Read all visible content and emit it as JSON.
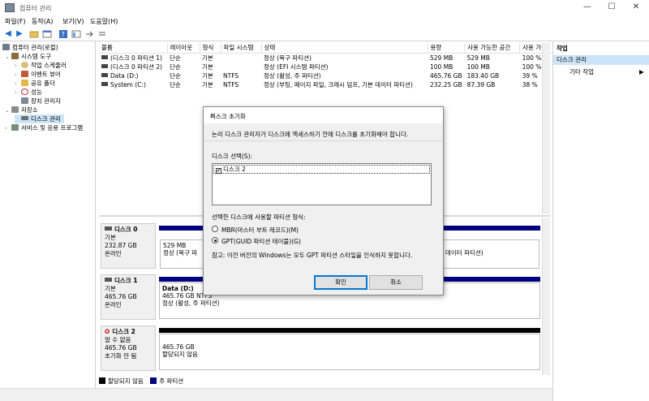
{
  "window": {
    "title": "컴퓨터 관리",
    "minimize": "—",
    "maximize": "☐",
    "close": "✕"
  },
  "menu": {
    "items": [
      "파일(F)",
      "동작(A)",
      "보기(V)",
      "도움말(H)"
    ]
  },
  "toolbar": {
    "icons": [
      "back-arrow-icon",
      "forward-arrow-icon",
      "up-folder-icon",
      "properties-icon",
      "help-icon",
      "view-icon",
      "connect-icon",
      "list-icon"
    ]
  },
  "tree": {
    "root": "컴퓨터 관리(로컬)",
    "items": [
      {
        "label": "시스템 도구",
        "indent": 1,
        "expander": "⌄"
      },
      {
        "label": "작업 스케줄러",
        "indent": 2,
        "expander": "›"
      },
      {
        "label": "이벤트 뷰어",
        "indent": 2,
        "expander": "›"
      },
      {
        "label": "공유 폴더",
        "indent": 2,
        "expander": "›"
      },
      {
        "label": "성능",
        "indent": 2,
        "expander": "›"
      },
      {
        "label": "장치 관리자",
        "indent": 2,
        "expander": ""
      },
      {
        "label": "저장소",
        "indent": 1,
        "expander": "⌄"
      },
      {
        "label": "디스크 관리",
        "indent": 2,
        "expander": "",
        "selected": true
      },
      {
        "label": "서비스 및 응용 프로그램",
        "indent": 1,
        "expander": "›"
      }
    ]
  },
  "volumes": {
    "headers": [
      "볼륨",
      "레이아웃",
      "형식",
      "파일 시스템",
      "상태",
      "용량",
      "사용 가능한 공간",
      "사용 가능"
    ],
    "rows": [
      [
        "(디스크 0 파티션 1)",
        "단순",
        "기본",
        "",
        "정상 (복구 파티션)",
        "529 MB",
        "529 MB",
        "100 %"
      ],
      [
        "(디스크 0 파티션 2)",
        "단순",
        "기본",
        "",
        "정상 (EFI 시스템 파티션)",
        "100 MB",
        "100 MB",
        "100 %"
      ],
      [
        "Data (D:)",
        "단순",
        "기본",
        "NTFS",
        "정상 (활성, 주 파티션)",
        "465.76 GB",
        "183.40 GB",
        "39 %"
      ],
      [
        "System (C:)",
        "단순",
        "기본",
        "NTFS",
        "정상 (부팅, 페이지 파일, 크래시 덤프, 기본 데이터 파티션)",
        "232.25 GB",
        "87.39 GB",
        "38 %"
      ]
    ]
  },
  "disks": [
    {
      "name": "디스크 0",
      "type": "기본",
      "size": "232.87 GB",
      "state": "온라인",
      "part1_size": "529 MB",
      "part1_status": "정상 (복구 파",
      "part3_status": "데이터 파티션)"
    },
    {
      "name": "디스크 1",
      "type": "기본",
      "size": "465.76 GB",
      "state": "온라인",
      "part_name": "Data  (D:)",
      "part_size": "465.76 GB NTFS",
      "part_status": "정상 (활성, 주 파티션)"
    },
    {
      "name": "디스크 2",
      "type": "알 수 없음",
      "size": "465.76 GB",
      "state": "초기화 안 됨",
      "part_size": "465.76 GB",
      "part_status": "할당되지 않음"
    }
  ],
  "legend": {
    "unallocated": "할당되지 않음",
    "primary": "주 파티션"
  },
  "actions": {
    "header": "작업",
    "section": "디스크 관리",
    "item": "기타 작업"
  },
  "dialog": {
    "title": "디스크 초기화",
    "message": "논리 디스크 관리자가 디스크에 액세스하기 전에 디스크를 초기화해야 합니다.",
    "select_label": "디스크 선택(S):",
    "disk_item": "디스크 2",
    "style_label": "선택한 디스크에 사용할 파티션 형식:",
    "mbr_option": "MBR(마스터 부트 레코드)(M)",
    "gpt_option": "GPT(GUID 파티션 테이블)(G)",
    "note": "참고: 이전 버전의 Windows는 모두 GPT 파티션 스타일을 인식하지 못합니다.",
    "ok": "확인",
    "cancel": "취소"
  },
  "colors": {
    "primary_partition": "#00007f",
    "unallocated": "#000000",
    "selection": "#cce4f7",
    "accent": "#0078d7"
  }
}
